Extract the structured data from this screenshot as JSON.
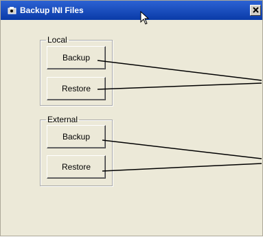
{
  "window": {
    "title": "Backup INI Files",
    "close_glyph": "✕",
    "title_color": "#0a3ba8"
  },
  "groups": [
    {
      "label": "Local",
      "backup_label": "Backup",
      "restore_label": "Restore"
    },
    {
      "label": "External",
      "backup_label": "Backup",
      "restore_label": "Restore"
    }
  ],
  "icons": [
    "app-icon",
    "close-icon",
    "mouse-cursor-icon"
  ]
}
